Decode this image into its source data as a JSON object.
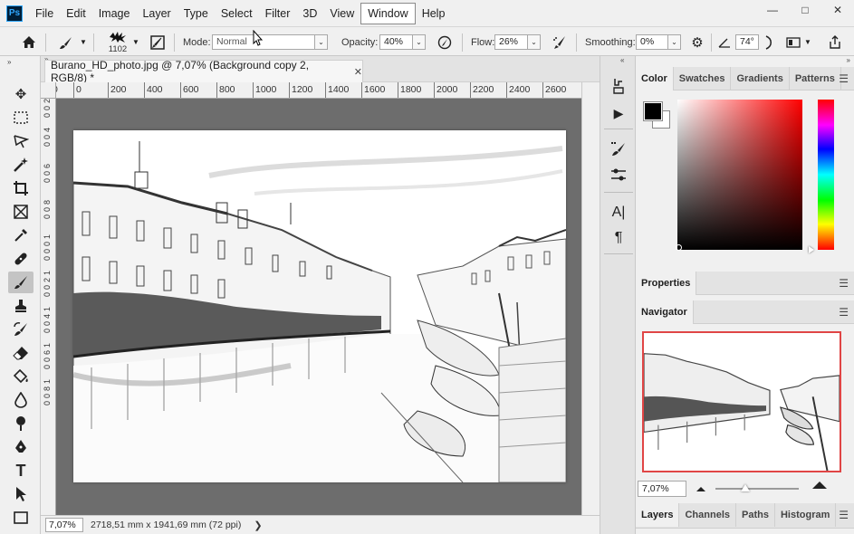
{
  "app": {
    "logo": "Ps"
  },
  "menu": [
    "File",
    "Edit",
    "Image",
    "Layer",
    "Type",
    "Select",
    "Filter",
    "3D",
    "View",
    "Window",
    "Help"
  ],
  "options": {
    "brush_size": "1102",
    "mode_label": "Mode:",
    "mode_value": "Normal",
    "opacity_label": "Opacity:",
    "opacity_value": "40%",
    "flow_label": "Flow:",
    "flow_value": "26%",
    "smoothing_label": "Smoothing:",
    "smoothing_value": "0%",
    "angle_value": "74°"
  },
  "document": {
    "tab_title": "Burano_HD_photo.jpg @ 7,07% (Background copy 2, RGB/8) *",
    "zoom": "7,07%",
    "doc_info": "2718,51 mm x 1941,69 mm (72 ppi)"
  },
  "ruler": {
    "top": [
      "0",
      "0",
      "200",
      "400",
      "600",
      "800",
      "1000",
      "1200",
      "1400",
      "1600",
      "1800",
      "2000",
      "2200",
      "2400",
      "2600"
    ],
    "left": [
      "2",
      "0",
      "0",
      "4",
      "0",
      "0",
      "6",
      "0",
      "0",
      "8",
      "0",
      "0",
      "1",
      "0",
      "0",
      "0",
      "1",
      "2",
      "0",
      "0",
      "1",
      "4",
      "0",
      "0",
      "1",
      "6",
      "0",
      "0",
      "1",
      "8",
      "0",
      "0"
    ]
  },
  "panels": {
    "color_tabs": [
      "Color",
      "Swatches",
      "Gradients",
      "Patterns"
    ],
    "properties_tab": "Properties",
    "navigator_tab": "Navigator",
    "navigator_zoom": "7,07%",
    "layers_tabs": [
      "Layers",
      "Channels",
      "Paths",
      "Histogram"
    ]
  },
  "colors": {
    "foreground": "#000000",
    "background": "#ffffff",
    "nav_frame": "#e04545"
  }
}
